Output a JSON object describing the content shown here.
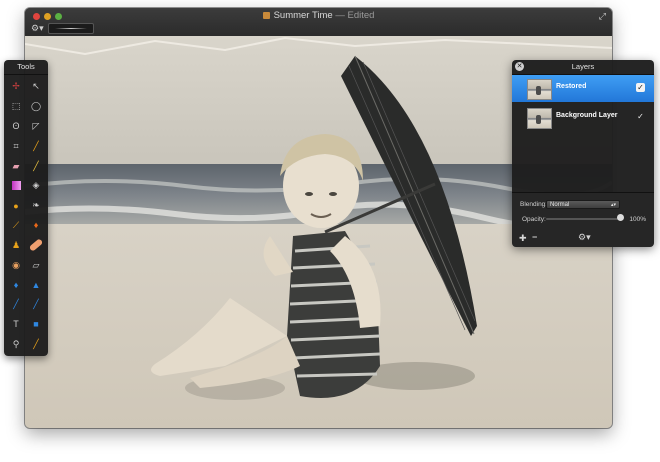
{
  "window": {
    "title": "Summer Time",
    "status": "— Edited",
    "fullscreen_icon": "fullscreen-arrows-icon",
    "toolbar_gear_icon": "gear-icon",
    "brush_preview": "brush-stroke-preview"
  },
  "tools_panel": {
    "title": "Tools",
    "tools": [
      {
        "name": "move-tool-icon",
        "glyph": "✢"
      },
      {
        "name": "magic-wand-pointer-icon",
        "glyph": "↖"
      },
      {
        "name": "rect-select-icon",
        "glyph": "▭"
      },
      {
        "name": "ellipse-select-icon",
        "glyph": "◯"
      },
      {
        "name": "lasso-icon",
        "glyph": "ʘ"
      },
      {
        "name": "polygon-lasso-icon",
        "glyph": "◸"
      },
      {
        "name": "crop-icon",
        "glyph": "⌗"
      },
      {
        "name": "eyedropper-icon",
        "glyph": "⟋"
      },
      {
        "name": "eraser-icon",
        "glyph": "▰"
      },
      {
        "name": "pencil-icon",
        "glyph": "✎"
      },
      {
        "name": "gradient-icon",
        "glyph": "▤"
      },
      {
        "name": "paint-bucket-icon",
        "glyph": "◈"
      },
      {
        "name": "sponge-icon",
        "glyph": "●"
      },
      {
        "name": "feather-icon",
        "glyph": "❧"
      },
      {
        "name": "brush-icon",
        "glyph": "⟋"
      },
      {
        "name": "burn-icon",
        "glyph": "♨"
      },
      {
        "name": "stamp-icon",
        "glyph": "♟"
      },
      {
        "name": "bandage-icon",
        "glyph": "▬"
      },
      {
        "name": "red-eye-icon",
        "glyph": "◉"
      },
      {
        "name": "smudge-icon",
        "glyph": "⌂"
      },
      {
        "name": "blur-drop-icon",
        "glyph": "💧"
      },
      {
        "name": "sharpen-icon",
        "glyph": "▲"
      },
      {
        "name": "pen-icon",
        "glyph": "╱"
      },
      {
        "name": "brush-pen-icon",
        "glyph": "╱"
      },
      {
        "name": "type-icon",
        "glyph": "T"
      },
      {
        "name": "shape-icon",
        "glyph": "■"
      },
      {
        "name": "zoom-icon",
        "glyph": "⚲"
      },
      {
        "name": "color-picker-icon",
        "glyph": "╱"
      }
    ],
    "colors": {
      "gradient": "#c233c2",
      "sponge": "#e8a21a",
      "bandage": "#f0a070",
      "burn": "#e8681a",
      "blue": "#2f87e0",
      "red-eye": "#e04040",
      "brush": "#e8a21a"
    }
  },
  "layers_panel": {
    "title": "Layers",
    "close_icon": "close-x-icon",
    "layers": [
      {
        "name": "Restored",
        "visible": true,
        "selected": true
      },
      {
        "name": "Background Layer",
        "visible": true,
        "selected": false
      }
    ],
    "blending_label": "Blending:",
    "blending_value": "Normal",
    "opacity_label": "Opacity:",
    "opacity_value": "100%",
    "opacity_fraction": 1.0,
    "add_icon": "plus-icon",
    "remove_icon": "minus-icon",
    "settings_icon": "gear-icon",
    "accent": "#2a86e6"
  }
}
